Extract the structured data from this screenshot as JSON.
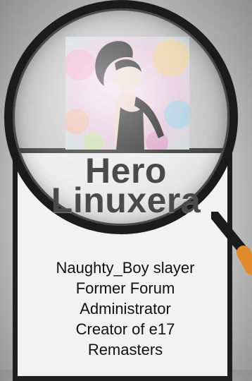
{
  "profile": {
    "title_line1": "Hero",
    "title_line2": "Linuxera",
    "bio_lines": [
      "Naughty_Boy slayer",
      "Former Forum",
      "Administrator",
      "Creator of e17",
      "Remasters"
    ]
  },
  "icons": {
    "magnifier": "magnifying-glass-icon"
  },
  "colors": {
    "frame": "#1e1e1e",
    "title_text": "#4a4a4a",
    "card_bg": "#f2f2f2",
    "handle_accent": "#e08a2c"
  }
}
